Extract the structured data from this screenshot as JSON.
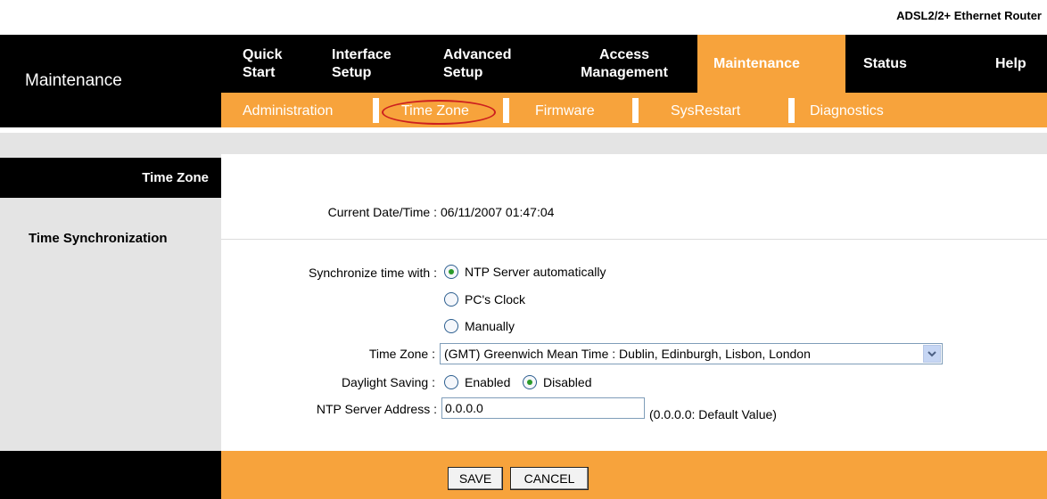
{
  "product": "ADSL2/2+ Ethernet Router",
  "section_title": "Maintenance",
  "menu": [
    {
      "label": "Quick Start"
    },
    {
      "label": "Interface Setup"
    },
    {
      "label": "Advanced Setup"
    },
    {
      "label": "Access Management"
    },
    {
      "label": "Maintenance",
      "active": true
    },
    {
      "label": "Status"
    },
    {
      "label": "Help"
    }
  ],
  "submenu": [
    "Administration",
    "Time Zone",
    "Firmware",
    "SysRestart",
    "Diagnostics"
  ],
  "colors": {
    "accent": "#f7a33c",
    "bar": "#000000",
    "panel": "#e4e4e4",
    "highlight_oval": "#cc1f1f"
  },
  "left": {
    "time_zone": "Time Zone",
    "time_sync": "Time Synchronization"
  },
  "current": {
    "label": "Current Date/Time :",
    "value": "06/11/2007 01:47:04"
  },
  "sync": {
    "label": "Synchronize time with :",
    "options": [
      "NTP Server automatically",
      "PC's Clock",
      "Manually"
    ],
    "selected": "NTP Server automatically"
  },
  "timezone": {
    "label": "Time Zone :",
    "value": "(GMT) Greenwich Mean Time : Dublin, Edinburgh, Lisbon, London"
  },
  "dst": {
    "label": "Daylight Saving :",
    "options": [
      "Enabled",
      "Disabled"
    ],
    "selected": "Disabled"
  },
  "ntp": {
    "label": "NTP Server Address :",
    "value": "0.0.0.0",
    "hint": "(0.0.0.0: Default Value)"
  },
  "buttons": {
    "save": "SAVE",
    "cancel": "CANCEL"
  }
}
